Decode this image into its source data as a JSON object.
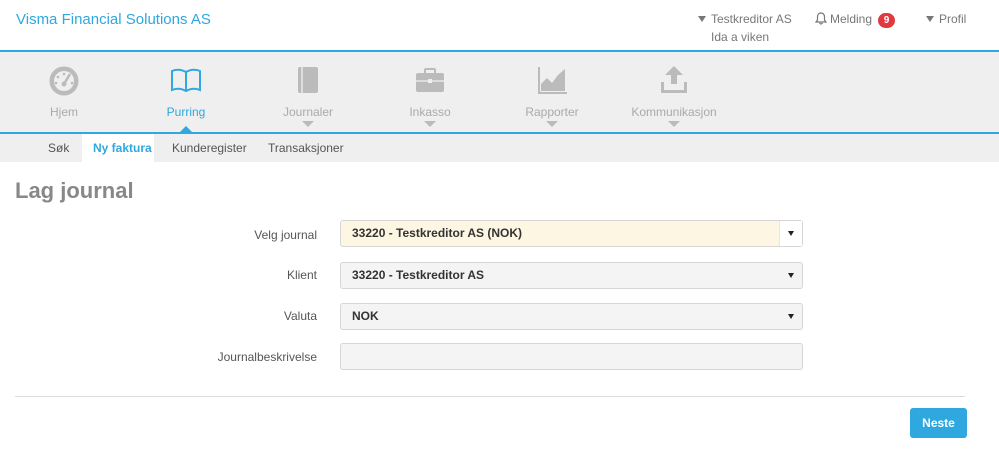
{
  "header": {
    "brand": "Visma Financial Solutions AS",
    "creditor": "Testkreditor AS",
    "user": "Ida a viken",
    "melding_label": "Melding",
    "melding_count": "9",
    "profil_label": "Profil"
  },
  "modules": [
    {
      "label": "Hjem",
      "icon": "dashboard-icon"
    },
    {
      "label": "Purring",
      "icon": "book-icon"
    },
    {
      "label": "Journaler",
      "icon": "journal-icon"
    },
    {
      "label": "Inkasso",
      "icon": "briefcase-icon"
    },
    {
      "label": "Rapporter",
      "icon": "chart-icon"
    },
    {
      "label": "Kommunikasjon",
      "icon": "upload-icon"
    }
  ],
  "subnav": [
    "Søk",
    "Ny faktura",
    "Kunderegister",
    "Transaksjoner"
  ],
  "page": {
    "title": "Lag journal",
    "fields": {
      "journal": {
        "label": "Velg journal",
        "value": "33220 - Testkreditor AS (NOK)"
      },
      "klient": {
        "label": "Klient",
        "value": "33220 - Testkreditor AS"
      },
      "valuta": {
        "label": "Valuta",
        "value": "NOK"
      },
      "beskrivelse": {
        "label": "Journalbeskrivelse",
        "value": ""
      }
    },
    "next_label": "Neste"
  },
  "colors": {
    "accent": "#2fa8df",
    "badge": "#e03a3e",
    "highlight": "#fdf6e3"
  }
}
